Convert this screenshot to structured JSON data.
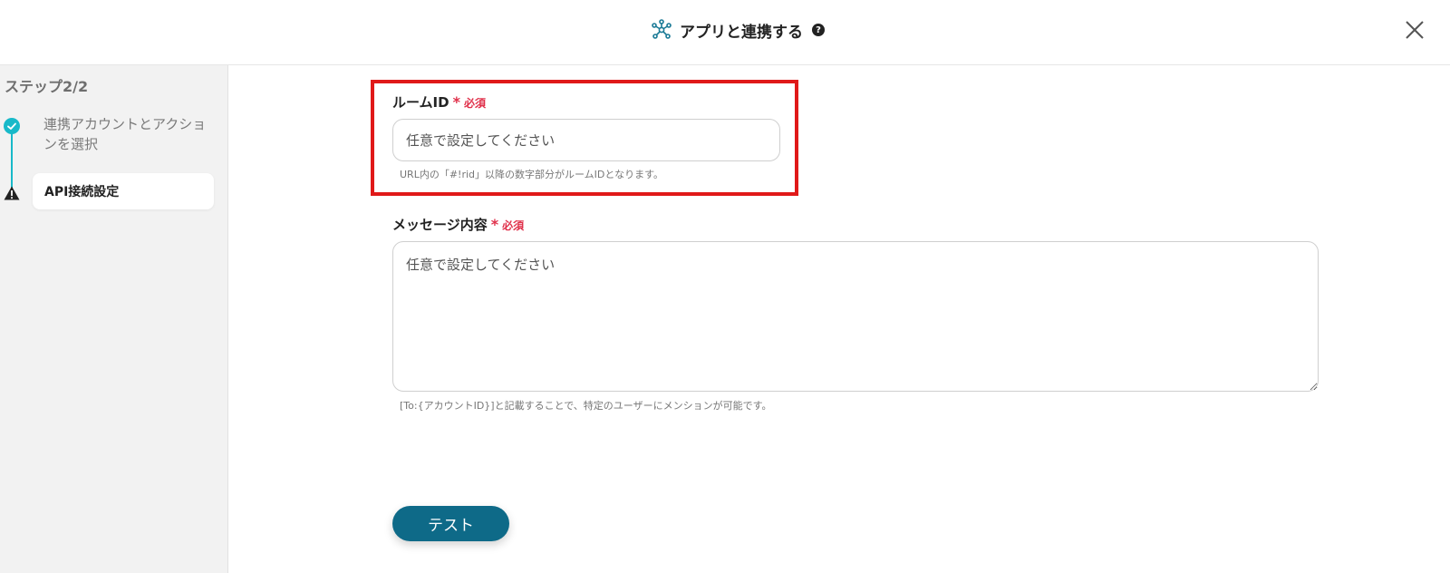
{
  "header": {
    "title": "アプリと連携する",
    "help_icon_glyph": "?",
    "close_icon": "close-icon",
    "app_icon": "network-hub-icon"
  },
  "sidebar": {
    "step_heading": "ステップ2/2",
    "steps": [
      {
        "label": "連携アカウントとアクションを選択",
        "status": "complete",
        "icon": "check-icon"
      },
      {
        "label": "API接続設定",
        "status": "current",
        "icon": "warning-icon"
      }
    ]
  },
  "form": {
    "room_id": {
      "label": "ルームID",
      "asterisk": "*",
      "required": "必須",
      "placeholder": "任意で設定してください",
      "help": "URL内の「#!rid」以降の数字部分がルームIDとなります。"
    },
    "message": {
      "label": "メッセージ内容",
      "asterisk": "*",
      "required": "必須",
      "placeholder": "任意で設定してください",
      "help": "[To:{アカウントID}]と記載することで、特定のユーザーにメンションが可能です。"
    },
    "test_button": "テスト"
  },
  "colors": {
    "accent": "#0e6a88",
    "timeline": "#18b9c9",
    "required": "#e0304a",
    "highlight": "#e01919"
  }
}
